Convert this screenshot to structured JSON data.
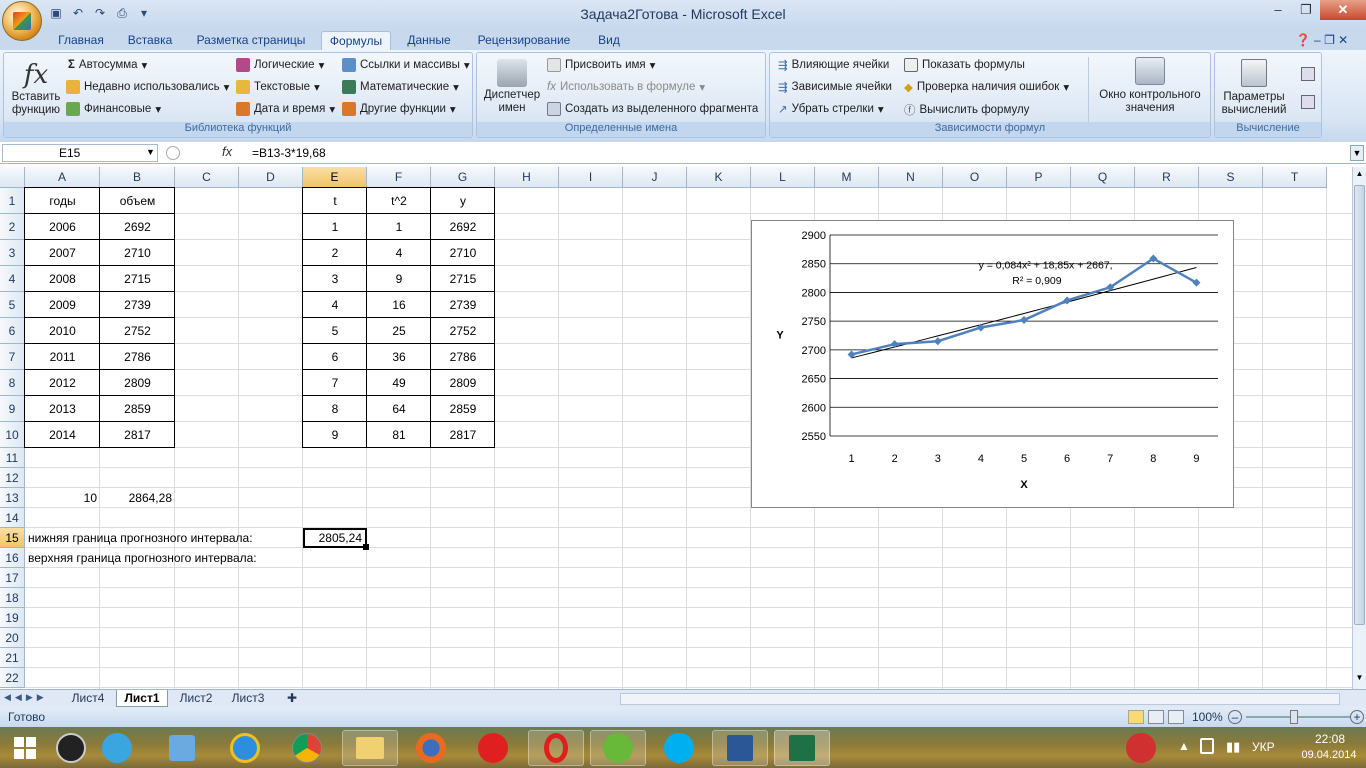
{
  "window": {
    "title": "Задача2Готова - Microsoft Excel"
  },
  "tabs": [
    "Главная",
    "Вставка",
    "Разметка страницы",
    "Формулы",
    "Данные",
    "Рецензирование",
    "Вид"
  ],
  "ribbon": {
    "insert_function": "Вставить функцию",
    "library": {
      "autosum": "Автосумма",
      "recent": "Недавно использовались",
      "financial": "Финансовые",
      "logical": "Логические",
      "text": "Текстовые",
      "datetime": "Дата и время",
      "refs": "Ссылки и массивы",
      "math": "Математические",
      "other": "Другие функции",
      "label": "Библиотека функций"
    },
    "names": {
      "manager": "Диспетчер имен",
      "assign": "Присвоить имя",
      "use": "Использовать в формуле",
      "create": "Создать из выделенного фрагмента",
      "label": "Определенные имена"
    },
    "audit": {
      "precedents": "Влияющие ячейки",
      "dependents": "Зависимые ячейки",
      "remove": "Убрать стрелки",
      "show": "Показать формулы",
      "errors": "Проверка наличия ошибок",
      "evaluate": "Вычислить формулу",
      "watch": "Окно контрольного значения",
      "label": "Зависимости формул"
    },
    "calc": {
      "options": "Параметры вычислений",
      "label": "Вычисление"
    }
  },
  "formula_bar": {
    "name_box": "E15",
    "fx": "fx",
    "formula": "=B13-3*19,68"
  },
  "columns": [
    "A",
    "B",
    "C",
    "D",
    "E",
    "F",
    "G",
    "H",
    "I",
    "J",
    "K",
    "L",
    "M",
    "N",
    "O",
    "P",
    "Q",
    "R",
    "S",
    "T"
  ],
  "rows": [
    "1",
    "2",
    "3",
    "4",
    "5",
    "6",
    "7",
    "8",
    "9",
    "10",
    "11",
    "12",
    "13",
    "14",
    "15",
    "16",
    "17",
    "18",
    "19",
    "20",
    "21",
    "22"
  ],
  "table1": {
    "headers": [
      "годы",
      "объем"
    ],
    "rows": [
      [
        "2006",
        "2692"
      ],
      [
        "2007",
        "2710"
      ],
      [
        "2008",
        "2715"
      ],
      [
        "2009",
        "2739"
      ],
      [
        "2010",
        "2752"
      ],
      [
        "2011",
        "2786"
      ],
      [
        "2012",
        "2809"
      ],
      [
        "2013",
        "2859"
      ],
      [
        "2014",
        "2817"
      ]
    ]
  },
  "table2": {
    "headers": [
      "t",
      "t^2",
      "y"
    ],
    "rows": [
      [
        "1",
        "1",
        "2692"
      ],
      [
        "2",
        "4",
        "2710"
      ],
      [
        "3",
        "9",
        "2715"
      ],
      [
        "4",
        "16",
        "2739"
      ],
      [
        "5",
        "25",
        "2752"
      ],
      [
        "6",
        "36",
        "2786"
      ],
      [
        "7",
        "49",
        "2809"
      ],
      [
        "8",
        "64",
        "2859"
      ],
      [
        "9",
        "81",
        "2817"
      ]
    ]
  },
  "row13": {
    "a": "10",
    "b": "2864,28"
  },
  "row15": {
    "label": "нижняя граница прогнозного интервала:",
    "value": "2805,24"
  },
  "row16": {
    "label": "верхняя граница прогнозного интервала:"
  },
  "chart_data": {
    "type": "line",
    "x": [
      1,
      2,
      3,
      4,
      5,
      6,
      7,
      8,
      9
    ],
    "series": [
      {
        "values": [
          2692,
          2710,
          2715,
          2739,
          2752,
          2786,
          2809,
          2859,
          2817
        ],
        "color": "#4f81bd"
      }
    ],
    "trendline": {
      "equation": "y = 0,084x² + 18,85x + 2667,",
      "r2": "R² = 0,909",
      "coef": [
        0.084,
        18.85,
        2667
      ]
    },
    "xticks": [
      "1",
      "2",
      "3",
      "4",
      "5",
      "6",
      "7",
      "8",
      "9"
    ],
    "yticks": [
      "2550",
      "2600",
      "2650",
      "2700",
      "2750",
      "2800",
      "2850",
      "2900"
    ],
    "ylim": [
      2550,
      2900
    ],
    "xlabel": "X",
    "ylabel": "Y",
    "grid": true
  },
  "sheets": [
    "Лист4",
    "Лист1",
    "Лист2",
    "Лист3"
  ],
  "active_sheet": "Лист1",
  "status": {
    "ready": "Готово",
    "zoom": "100%"
  },
  "tray": {
    "lang": "УКР",
    "time": "22:08",
    "date": "09.04.2014"
  }
}
